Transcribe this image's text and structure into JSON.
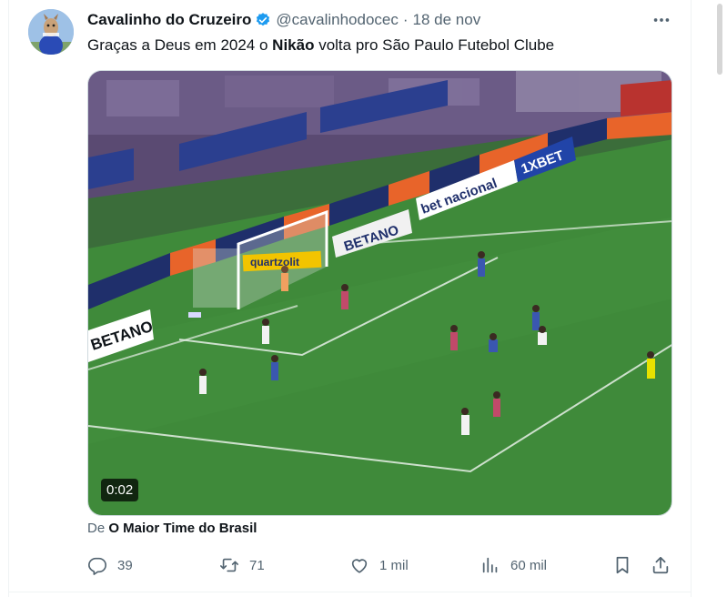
{
  "tweet": {
    "author_name": "Cavalinho do Cruzeiro",
    "handle": "@cavalinhodocec",
    "separator": "·",
    "date": "18 de nov",
    "text_before": "Graças a Deus em 2024 o ",
    "text_bold": "Nikão",
    "text_after": " volta pro São Paulo Futebol Clube",
    "video_time": "0:02",
    "source_prefix": "De ",
    "source_name": "O Maior Time do Brasil",
    "pitch_banners": [
      "BETANO",
      "bet nacional",
      "1XBET",
      "quartzolit"
    ]
  },
  "actions": {
    "reply_count": "39",
    "retweet_count": "71",
    "like_count": "1 mil",
    "view_count": "60 mil"
  },
  "colors": {
    "verified": "#1d9bf0",
    "text_secondary": "#536471",
    "pitch": "#3f8a3a",
    "banner_orange": "#e8642a",
    "banner_navy": "#1f2f6b"
  },
  "icons": {
    "more": "more-horizontal-icon",
    "reply": "reply-icon",
    "retweet": "retweet-icon",
    "like": "heart-icon",
    "views": "analytics-icon",
    "bookmark": "bookmark-icon",
    "share": "share-icon",
    "verified": "verified-badge-icon"
  }
}
